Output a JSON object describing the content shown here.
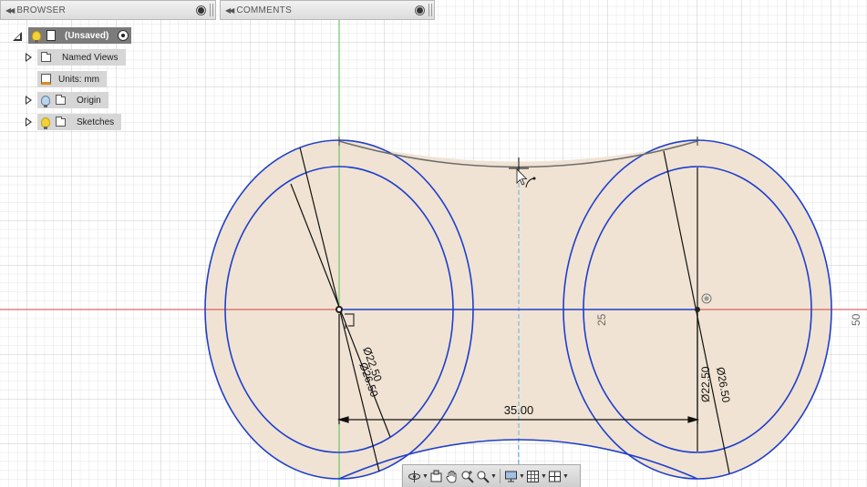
{
  "browser": {
    "title": "BROWSER",
    "root": {
      "label": "(Unsaved)"
    },
    "items": [
      {
        "label": "Named Views"
      },
      {
        "label": "Units: mm"
      },
      {
        "label": "Origin"
      },
      {
        "label": "Sketches"
      }
    ]
  },
  "comments": {
    "title": "COMMENTS"
  },
  "sketch": {
    "dim_horizontal": "35.00",
    "dim_left_inner": "Ø22.50",
    "dim_left_outer": "Ø26.50",
    "dim_right_inner": "Ø22.50",
    "dim_right_outer": "Ø26.50",
    "ruler_25": "25",
    "ruler_50": "50"
  },
  "colors": {
    "grid_minor": "#e3e3e3",
    "grid_major": "#c9c9c9",
    "x_axis": "#d94040",
    "y_axis": "#4fbf4f",
    "sketch_line": "#1f3fcc",
    "profile_fill": "#f0e3d3",
    "construction": "#5ab4e6"
  },
  "toolbar": {
    "icons": [
      "orbit-icon",
      "look-at-icon",
      "pan-icon",
      "zoom-fit-icon",
      "zoom-icon",
      "display-settings-icon",
      "grid-settings-icon",
      "viewports-icon"
    ]
  }
}
